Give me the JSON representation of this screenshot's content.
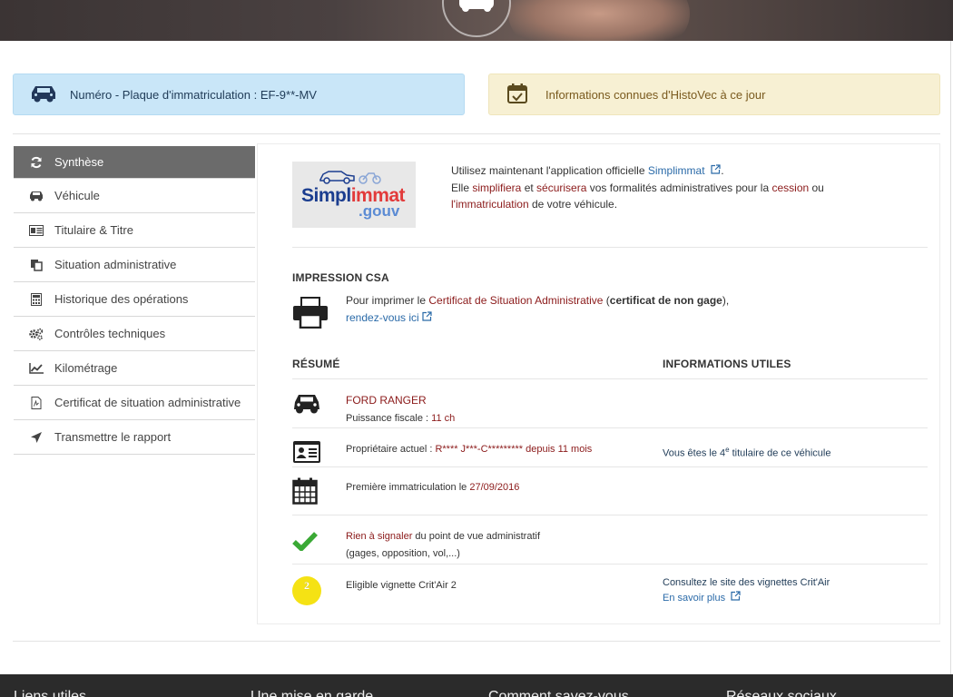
{
  "banner": {
    "plate_label": "Numéro - Plaque d'immatriculation : EF-9**-MV",
    "histovec_label": "Informations connues d'HistoVec à ce jour"
  },
  "sidebar": {
    "items": [
      {
        "label": "Synthèse",
        "icon": "refresh-icon",
        "active": true
      },
      {
        "label": "Véhicule",
        "icon": "car-icon"
      },
      {
        "label": "Titulaire & Titre",
        "icon": "id-card-icon"
      },
      {
        "label": "Situation administrative",
        "icon": "copy-icon"
      },
      {
        "label": "Historique des opérations",
        "icon": "calculator-icon"
      },
      {
        "label": "Contrôles techniques",
        "icon": "gears-icon"
      },
      {
        "label": "Kilométrage",
        "icon": "line-chart-icon"
      },
      {
        "label": "Certificat de situation administrative",
        "icon": "pdf-file-icon"
      },
      {
        "label": "Transmettre le rapport",
        "icon": "send-icon"
      }
    ]
  },
  "simplimmat": {
    "logo_text_1": "Simpl",
    "logo_text_2": "immat",
    "logo_text_3": ".gouv",
    "line1_prefix": "Utilisez maintenant l'application officielle ",
    "line1_link": "Simplimmat",
    "line1_suffix": ".",
    "line2_a": "Elle ",
    "line2_b": "simplifiera",
    "line2_c": " et ",
    "line2_d": "sécurisera",
    "line2_e": " vos formalités administratives pour la ",
    "line2_f": "cession",
    "line2_g": " ou",
    "line3_a": "l'immatriculation",
    "line3_b": " de votre véhicule."
  },
  "csa": {
    "title": "IMPRESSION CSA",
    "text_a": "Pour imprimer le ",
    "text_b": "Certificat de Situation Administrative",
    "text_c": " (",
    "text_d": "certificat de non gage",
    "text_e": "),",
    "link": "rendez-vous ici"
  },
  "resume": {
    "title": "RÉSUMÉ",
    "info_title": "INFORMATIONS UTILES",
    "vehicle_name": "FORD RANGER",
    "puissance_label": "Puissance fiscale : ",
    "puissance_value": "11 ch",
    "owner_label": "Propriétaire actuel : ",
    "owner_value": "R**** J***-C********* depuis 11 mois",
    "owner_info_a": "Vous êtes le 4",
    "owner_info_sup": "e",
    "owner_info_b": " titulaire de ce véhicule",
    "first_reg_label": "Première immatriculation le ",
    "first_reg_value": "27/09/2016",
    "admin_status_a": "Rien à signaler",
    "admin_status_b": " du point de vue administratif",
    "admin_status_detail": "(gages, opposition, vol,...)",
    "critair_label": "Eligible vignette Crit'Air 2",
    "critair_badge": "2",
    "critair_info_link": "Consultez le site des vignettes Crit'Air",
    "critair_more": "En savoir plus"
  },
  "footer": {
    "col1": "Liens utiles",
    "col2": "Une mise en garde",
    "col3": "Comment savez-vous",
    "col4": "Réseaux sociaux"
  },
  "colors": {
    "plate_bg": "#c9e6f8",
    "histo_bg": "#f7f0d3",
    "active_nav": "#6b6b6b",
    "accent_red": "#8b1a1a",
    "link_blue": "#2a6aa8",
    "check_green": "#3aa935",
    "critair_yellow": "#f5e214"
  }
}
